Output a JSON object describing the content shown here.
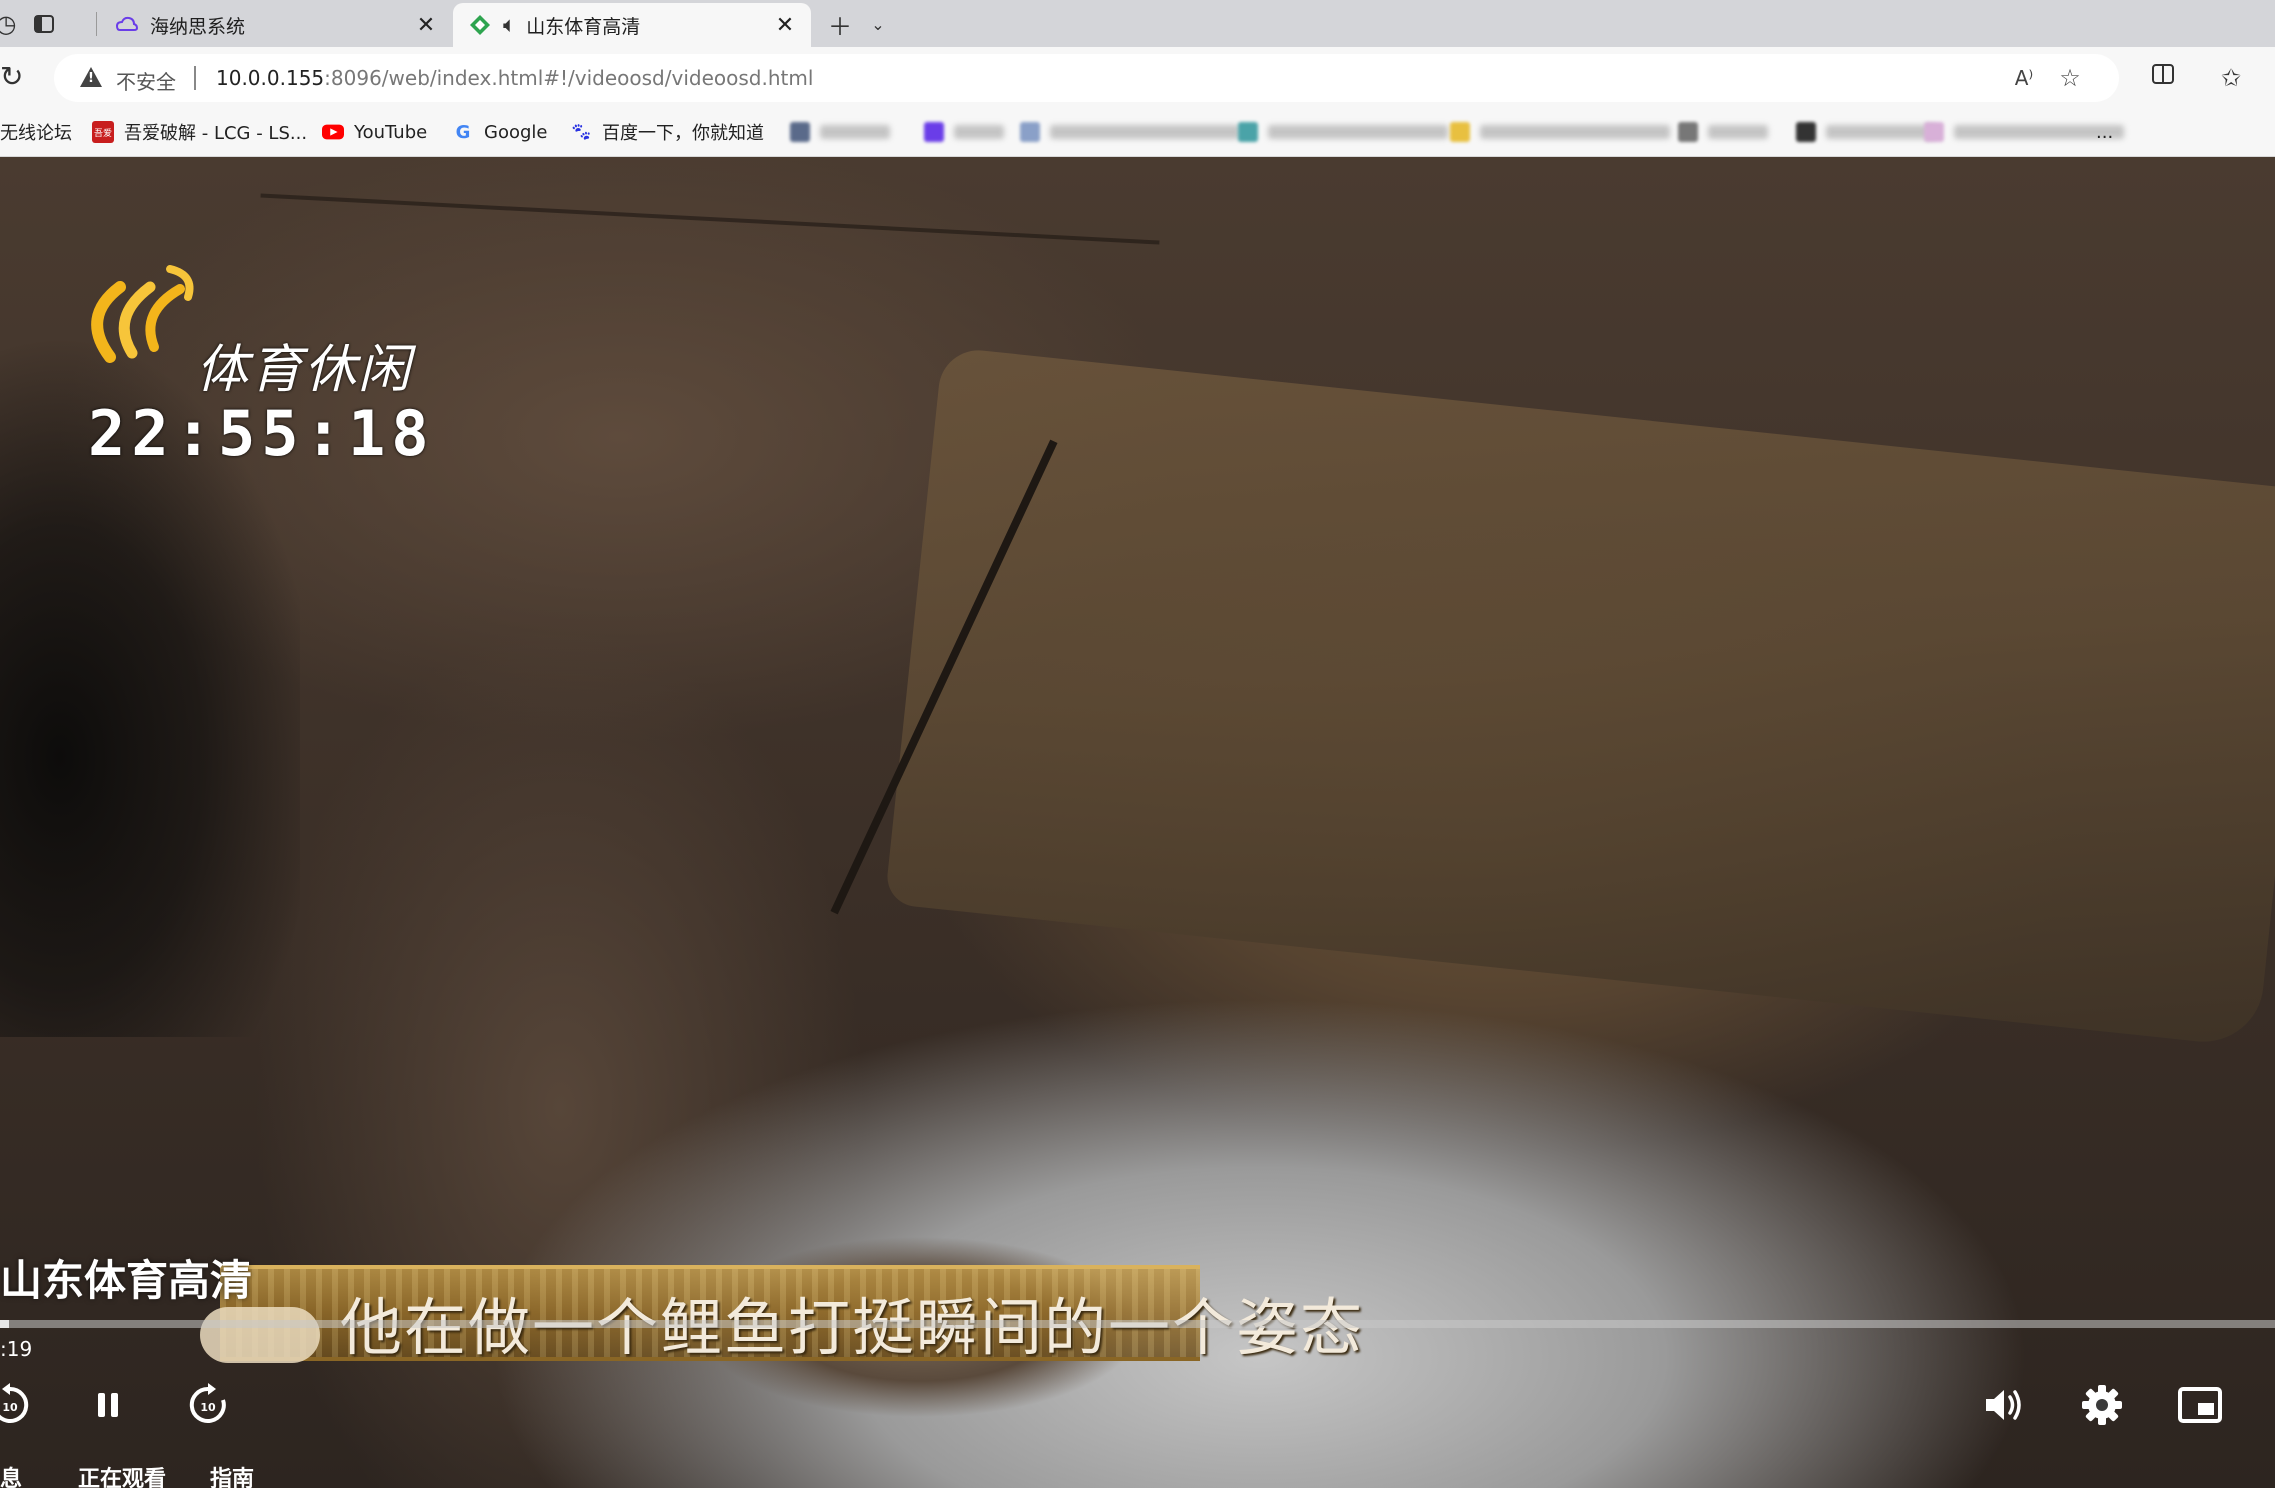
{
  "tabs": [
    {
      "title": "海纳思系统",
      "favicon": "cloud-icon",
      "active": false
    },
    {
      "title": "山东体育高清",
      "favicon": "green-diamond-icon",
      "active": true,
      "audio": true
    }
  ],
  "address_bar": {
    "security_label": "不安全",
    "url_host": "10.0.0.155",
    "url_rest": ":8096/web/index.html#!/videoosd/videoosd.html"
  },
  "bookmarks": [
    {
      "label": "无线论坛",
      "icon": "forum-icon"
    },
    {
      "label": "吾爱破解 - LCG - LS...",
      "icon": "52pojie-icon"
    },
    {
      "label": "YouTube",
      "icon": "youtube-icon"
    },
    {
      "label": "Google",
      "icon": "google-icon"
    },
    {
      "label": "百度一下，你就知道",
      "icon": "baidu-icon"
    }
  ],
  "overflow_label": "...",
  "video": {
    "channel_logo_text": "体育休闲",
    "clock": "22:55:18",
    "subtitle": "他在做一个鲤鱼打挺瞬间的一个姿态",
    "title": "山东体育高清",
    "elapsed": ":19"
  },
  "player": {
    "rewind_label": "10",
    "forward_label": "10",
    "bottom_buttons": [
      "信息",
      "正在观看",
      "指南"
    ]
  },
  "colors": {
    "tabstrip_bg": "#d4d5d9",
    "toolbar_bg": "#f7f7f7",
    "youtube_red": "#ff0000",
    "accent_purple": "#6a3de8"
  }
}
